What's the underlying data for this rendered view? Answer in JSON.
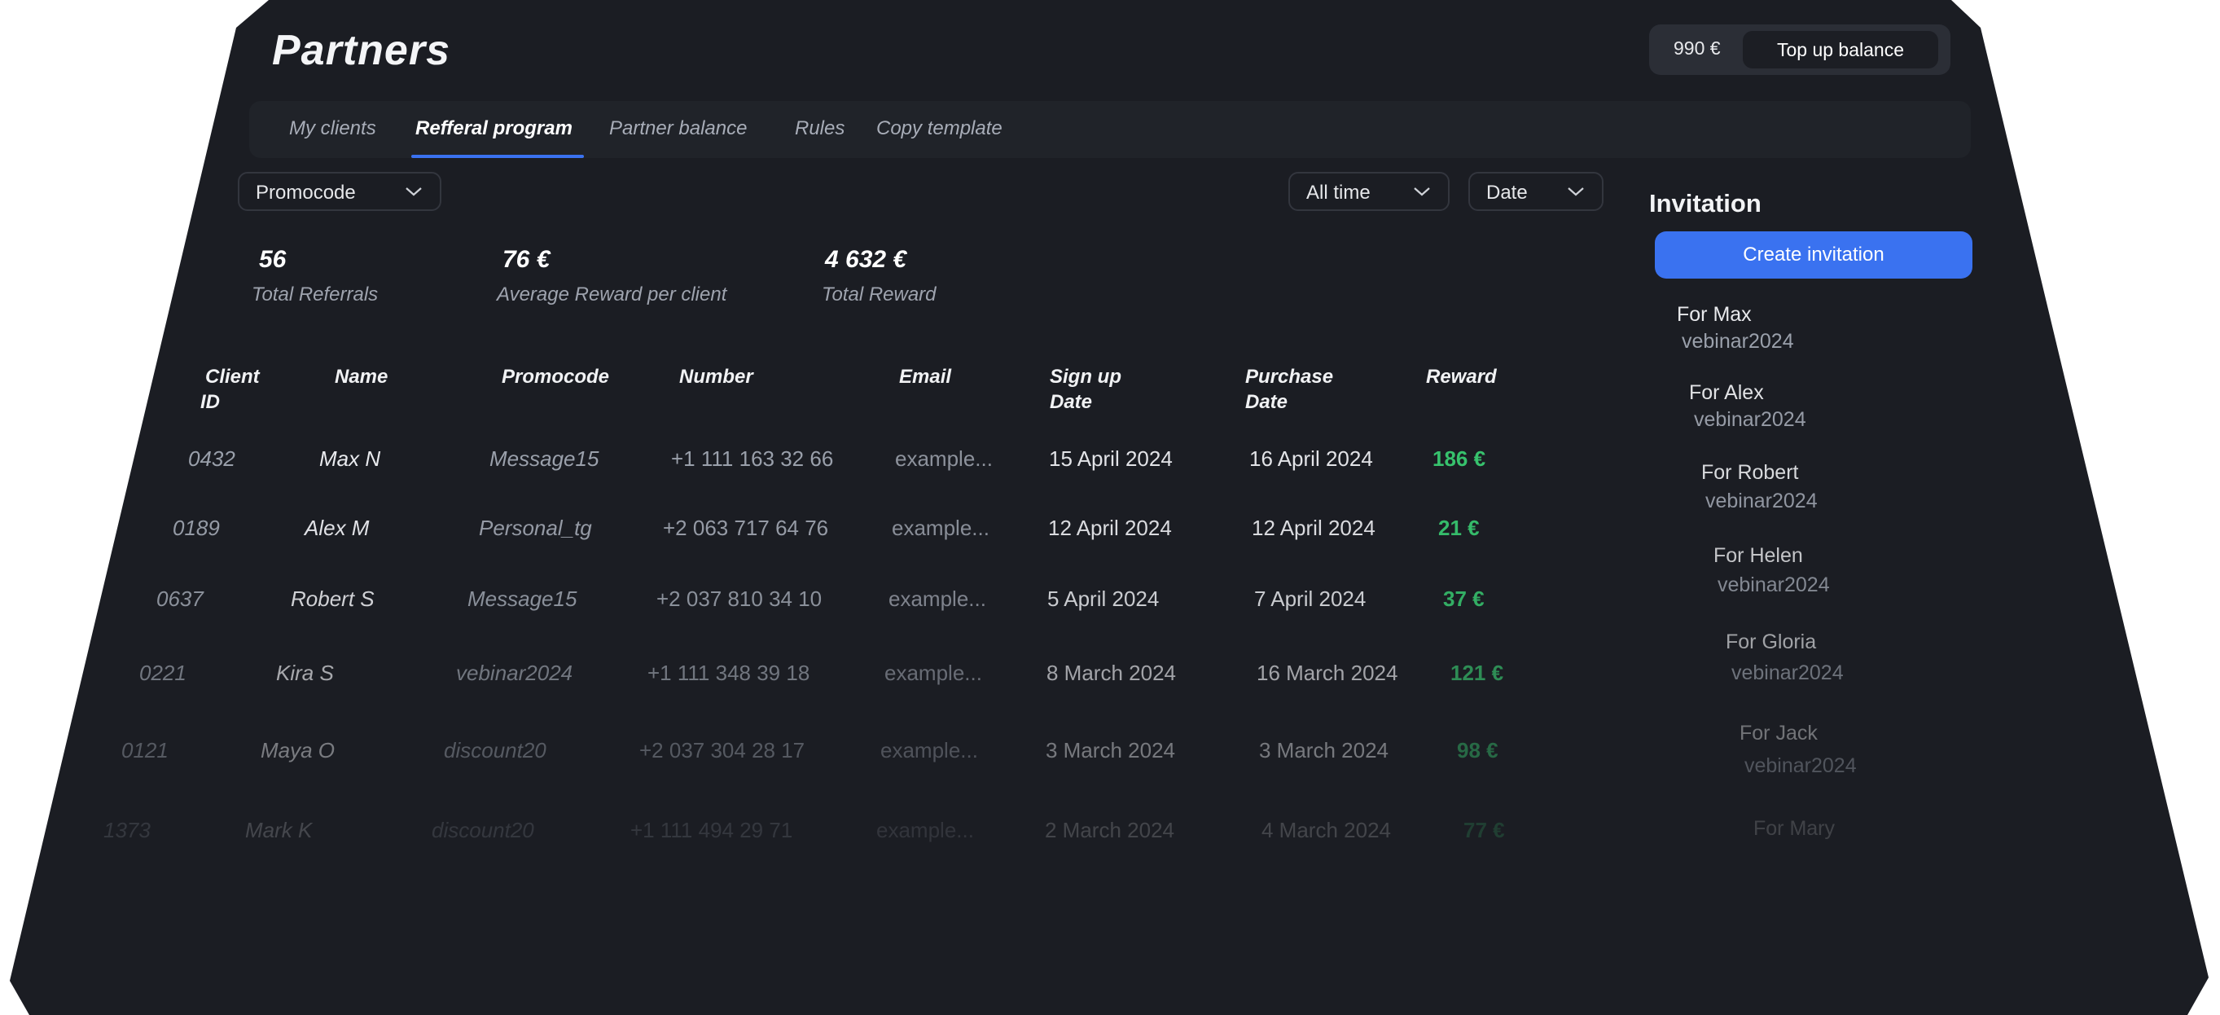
{
  "header": {
    "title": "Partners",
    "balance": "990 €",
    "topup_label": "Top up balance"
  },
  "tabs": [
    {
      "label": "My clients",
      "active": false
    },
    {
      "label": "Refferal program",
      "active": true
    },
    {
      "label": "Partner balance",
      "active": false
    },
    {
      "label": "Rules",
      "active": false
    },
    {
      "label": "Copy template",
      "active": false
    }
  ],
  "filters": {
    "promocode": "Promocode",
    "period": "All time",
    "sort": "Date"
  },
  "stats": [
    {
      "value": "56",
      "label": "Total Referrals"
    },
    {
      "value": "76 €",
      "label": "Average Reward per client"
    },
    {
      "value": "4 632 €",
      "label": "Total Reward"
    }
  ],
  "table": {
    "headers": {
      "client_id": [
        "Client",
        "ID"
      ],
      "name": [
        "Name"
      ],
      "promocode": [
        "Promocode"
      ],
      "number": [
        "Number"
      ],
      "email": [
        "Email"
      ],
      "signup": [
        "Sign up",
        "Date"
      ],
      "purchase": [
        "Purchase",
        "Date"
      ],
      "reward": [
        "Reward"
      ]
    },
    "rows": [
      {
        "id": "0432",
        "name": "Max N",
        "promocode": "Message15",
        "number": "+1 111 163 32 66",
        "email": "example...",
        "signup": "15 April 2024",
        "purchase": "16 April 2024",
        "reward": "186 €"
      },
      {
        "id": "0189",
        "name": "Alex M",
        "promocode": "Personal_tg",
        "number": "+2 063 717 64 76",
        "email": "example...",
        "signup": "12 April 2024",
        "purchase": "12 April 2024",
        "reward": "21 €"
      },
      {
        "id": "0637",
        "name": "Robert S",
        "promocode": "Message15",
        "number": "+2 037 810 34 10",
        "email": "example...",
        "signup": "5 April 2024",
        "purchase": "7 April 2024",
        "reward": "37 €"
      },
      {
        "id": "0221",
        "name": "Kira S",
        "promocode": "vebinar2024",
        "number": "+1 111 348 39 18",
        "email": "example...",
        "signup": "8 March 2024",
        "purchase": "16 March 2024",
        "reward": "121 €"
      },
      {
        "id": "0121",
        "name": "Maya O",
        "promocode": "discount20",
        "number": "+2 037 304 28 17",
        "email": "example...",
        "signup": "3 March 2024",
        "purchase": "3 March 2024",
        "reward": "98 €"
      },
      {
        "id": "1373",
        "name": "Mark K",
        "promocode": "discount20",
        "number": "+1 111 494 29 71",
        "email": "example...",
        "signup": "2 March 2024",
        "purchase": "4 March 2024",
        "reward": "77 €"
      }
    ]
  },
  "invitations": {
    "title": "Invitation",
    "create_label": "Create invitation",
    "items": [
      {
        "for": "For Max",
        "code": "vebinar2024"
      },
      {
        "for": "For Alex",
        "code": "vebinar2024"
      },
      {
        "for": "For Robert",
        "code": "vebinar2024"
      },
      {
        "for": "For Helen",
        "code": "vebinar2024"
      },
      {
        "for": "For Gloria",
        "code": "vebinar2024"
      },
      {
        "for": "For Jack",
        "code": "vebinar2024"
      },
      {
        "for": "For Mary",
        "code": ""
      }
    ]
  }
}
